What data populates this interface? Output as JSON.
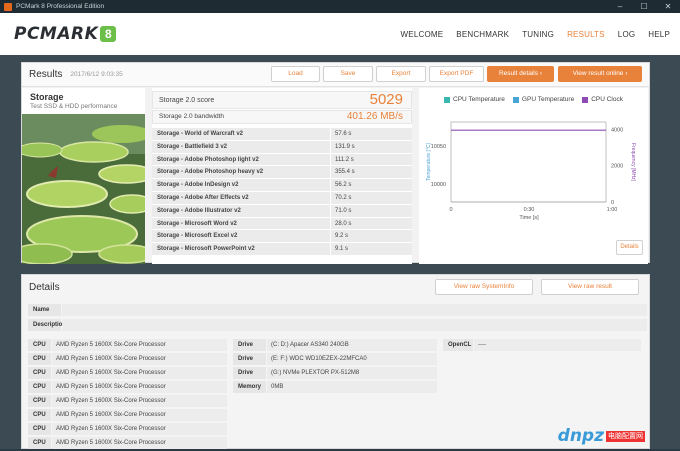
{
  "window": {
    "title": "PCMark 8 Professional Edition",
    "controls": [
      "–",
      "☐",
      "✕"
    ]
  },
  "header": {
    "logo_text": "PCMARK",
    "logo_badge": "8",
    "nav": [
      "WELCOME",
      "BENCHMARK",
      "TUNING",
      "RESULTS",
      "LOG",
      "HELP"
    ],
    "active_nav": "RESULTS"
  },
  "results": {
    "title": "Results",
    "date": "2017/6/12 9:03:35",
    "buttons": [
      "Load",
      "Save",
      "Export",
      "Export PDF"
    ],
    "result_details_label": "Result details",
    "view_online_label": "View result online",
    "storage": {
      "name": "Storage",
      "desc": "Test SSD & HDD performance"
    },
    "score_label": "Storage 2.0 score",
    "score_value": "5029",
    "bandwidth_label": "Storage 2.0 bandwidth",
    "bandwidth_value": "401.26 MB/s",
    "tests": [
      {
        "name": "Storage - World of Warcraft v2",
        "value": "57.6 s"
      },
      {
        "name": "Storage - Battlefield 3 v2",
        "value": "131.9 s"
      },
      {
        "name": "Storage - Adobe Photoshop light v2",
        "value": "111.2 s"
      },
      {
        "name": "Storage - Adobe Photoshop heavy v2",
        "value": "355.4 s"
      },
      {
        "name": "Storage - Adobe InDesign v2",
        "value": "56.2 s"
      },
      {
        "name": "Storage - Adobe After Effects v2",
        "value": "70.2 s"
      },
      {
        "name": "Storage - Adobe Illustrator v2",
        "value": "71.0 s"
      },
      {
        "name": "Storage - Microsoft Word v2",
        "value": "28.0 s"
      },
      {
        "name": "Storage - Microsoft Excel v2",
        "value": "9.2 s"
      },
      {
        "name": "Storage - Microsoft PowerPoint v2",
        "value": "9.1 s"
      }
    ],
    "details_button": "Details"
  },
  "chart_data": {
    "type": "line",
    "legend": [
      {
        "name": "CPU Temperature",
        "color": "#3ab7b0"
      },
      {
        "name": "GPU Temperature",
        "color": "#4aa3d6"
      },
      {
        "name": "CPU Clock",
        "color": "#8e4bb3"
      }
    ],
    "xlabel": "Time [s]",
    "x_ticks": [
      "0",
      "0:30",
      "1:00"
    ],
    "ylabel_left": "Temperature [°C]",
    "y_left_ticks": [
      "10050",
      "10000"
    ],
    "ylabel_right": "Frequency [MHz]",
    "y_right_ticks": [
      "4000",
      "2000",
      "0"
    ],
    "y_right_lim": [
      0,
      4400
    ],
    "series": [
      {
        "name": "CPU Clock",
        "x": [
          0,
          60
        ],
        "values": [
          3950,
          3950
        ]
      }
    ]
  },
  "details": {
    "title": "Details",
    "btn_systeminfo": "View raw SystemInfo",
    "btn_raw_result": "View raw result",
    "name_label": "Name",
    "name_value": "",
    "desc_label": "Description",
    "desc_value": "",
    "cpu_label": "CPU",
    "cpu_rows": [
      "AMD Ryzen 5 1600X Six-Core Processor",
      "AMD Ryzen 5 1600X Six-Core Processor",
      "AMD Ryzen 5 1600X Six-Core Processor",
      "AMD Ryzen 5 1600X Six-Core Processor",
      "AMD Ryzen 5 1600X Six-Core Processor",
      "AMD Ryzen 5 1600X Six-Core Processor",
      "AMD Ryzen 5 1600X Six-Core Processor",
      "AMD Ryzen 5 1600X Six-Core Processor"
    ],
    "drives": [
      {
        "label": "Drive",
        "value": "(C: D:) Apacer AS340 240GB"
      },
      {
        "label": "Drive",
        "value": "(E: F:) WDC WD10EZEX-22MFCA0"
      },
      {
        "label": "Drive",
        "value": "(G:) NVMe PLEXTOR PX-512M8"
      },
      {
        "label": "Memory",
        "value": "0MB"
      }
    ],
    "opencl_label": "OpenCL",
    "opencl_value": "----"
  },
  "watermark": {
    "text": "dnpz",
    "tag": "电脑配置网"
  }
}
